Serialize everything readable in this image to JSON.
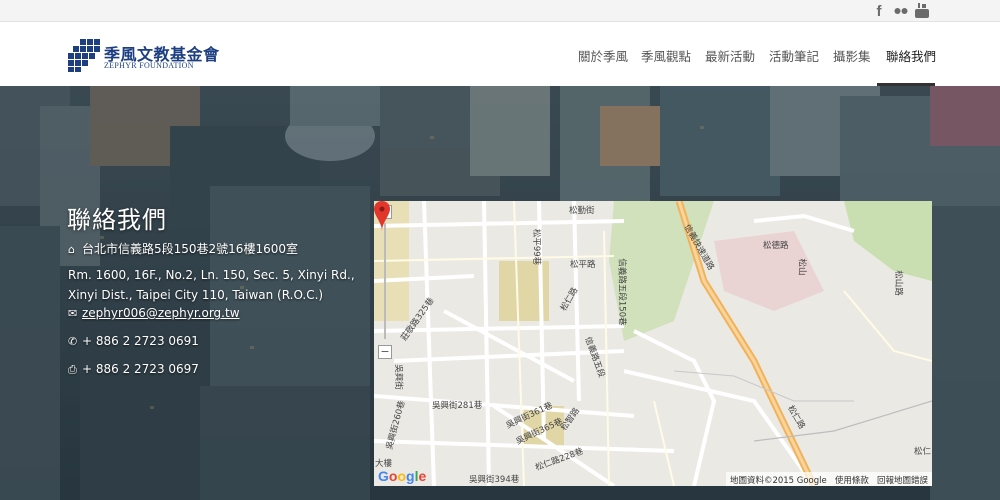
{
  "social": {
    "facebook_icon": "facebook-icon",
    "flickr_icon": "flickr-icon",
    "youtube_icon": "youtube-icon",
    "facebook_glyph": "f",
    "youtube_glyph": "You"
  },
  "header": {
    "logo_cn": "季風文教基金會",
    "logo_en": "ZEPHYR FOUNDATION",
    "nav": [
      {
        "label": "關於季風"
      },
      {
        "label": "季風觀點"
      },
      {
        "label": "最新活動"
      },
      {
        "label": "活動筆記"
      },
      {
        "label": "攝影集"
      },
      {
        "label": "聯絡我們"
      }
    ],
    "active_index": 5,
    "brand_color": "#1d3f82"
  },
  "contact": {
    "title": "聯絡我們",
    "address_cn": "台北市信義路5段150巷2號16樓1600室",
    "address_en_1": "Rm. 1600, 16F., No.2, Ln. 150, Sec. 5, Xinyi Rd.,",
    "address_en_2": "Xinyi Dist., Taipei City 110, Taiwan (R.O.C.)",
    "email": "zephyr006@zephyr.org.tw",
    "phone": "+ 886 2 2723 0691",
    "fax": "+ 886 2 2723 0697",
    "icons": {
      "home": "home-icon",
      "mail": "envelope-icon",
      "phone": "phone-icon",
      "fax": "fax-icon"
    }
  },
  "map": {
    "zoom_in": "+",
    "zoom_out": "−",
    "google": "Google",
    "footer_data": "地圖資料©2015 Google",
    "footer_terms": "使用條款",
    "footer_report": "回報地圖錯誤",
    "labels": [
      "松勤街",
      "松平路",
      "松德路",
      "信義快速道路",
      "松仁路",
      "莊敬路325巷",
      "吳興街",
      "吳興街281巷",
      "吳興街361巷",
      "吳興街365巷",
      "松仁路228巷",
      "吳興街394巷",
      "信義路五段150巷",
      "松智路",
      "大樓",
      "松山路",
      "吳興街260巷",
      "松仁",
      "信義路五段",
      "松平99巷",
      "松仁路",
      "松山"
    ]
  }
}
